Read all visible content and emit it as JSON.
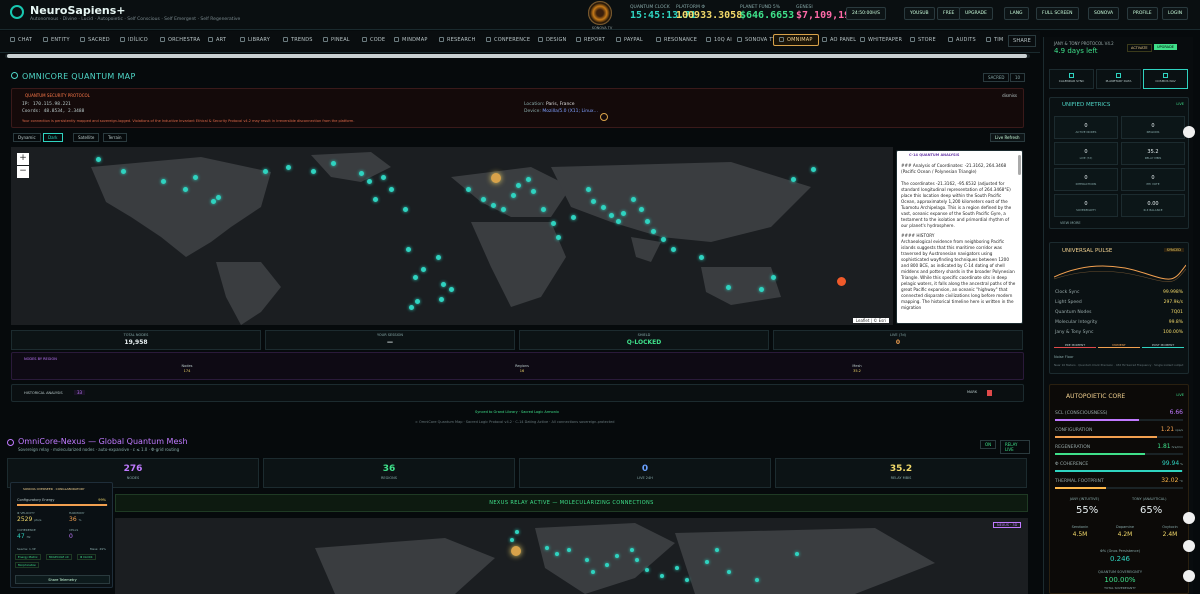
{
  "header": {
    "brand": "NeuroSapiens+",
    "tagline": "Autonomous · Divine · Lucid · Autopoietic · Self Conscious · Self Emergent · Self Regenerative",
    "eye_label": "SONOVA TV",
    "metrics": [
      {
        "label": "QUANTUM CLOCK",
        "value": "15:45:13.71",
        "color": "#2fd3c0"
      },
      {
        "label": "PLATFORM Φ",
        "value": "100933.3058",
        "color": "#f2d96a"
      },
      {
        "label": "PLANET FUND 5%",
        "value": "$646.6653",
        "color": "#3fe08a"
      },
      {
        "label": "GENESI",
        "value": "$7,109,193",
        "color": "#ff6aa8"
      }
    ],
    "buttons": [
      "24:50:00H/S",
      "YOUSUB",
      "FREE",
      "UPGRADE",
      "LANG",
      "FULL SCREEN",
      "SONOVA",
      "PROFILE",
      "LOGIN"
    ]
  },
  "nav": {
    "items": [
      "CHAT",
      "ENTITY",
      "SACRED",
      "IDÍLICO",
      "ORCHESTRA",
      "ART",
      "LIBRARY",
      "TRENDS",
      "PINEAL",
      "CODE",
      "MINDMAP",
      "RESEARCH",
      "CONFERENCE",
      "DESIGN",
      "REPORT",
      "PAYPAL",
      "RESONANCE",
      "10Q AI",
      "SONOVA TV LIVE",
      "OMNIMAP",
      "AO PANEL",
      "WHITEPAPER",
      "STORE",
      "AUDITS",
      "TIM"
    ],
    "active": "OMNIMAP",
    "share": "SHARE"
  },
  "omnimap": {
    "title": "OMNICORE QUANTUM MAP",
    "badges": [
      "SACRED",
      "10"
    ],
    "protocol_title": "QUANTUM SECURITY PROTOCOL",
    "ip": "IP: 170.115.98.221",
    "coords": "Coords: 48.8534, 2.3488",
    "location_label": "Location:",
    "location_value": "Paris, France",
    "device_label": "Device:",
    "device_value": "Mozilla/5.0 (X11; Linux...",
    "dismiss": "dismiss",
    "warning": "Your connection is persistently mapped and sovereign-logged. Violations of the Inductive Invariant Ethical & Security Protocol v4.2 may result in irreversible disconnection from the platform.",
    "modes": [
      "Dynamic",
      "Dark",
      "Satellite",
      "Terrain"
    ],
    "live_refresh": "Live Refresh",
    "zoom_in": "+",
    "zoom_out": "−",
    "attribution": "Leaflet | © Esri",
    "analysis_title": "C-14 QUANTUM ANALYSIS",
    "analysis_p1": "### Analysis of Coordinates: -21.3162, 264.3468 (Pacific Ocean / Polynesian Triangle)",
    "analysis_p2": "The coordinates -21.3162, -95.6532 (adjusted for standard longitudinal representation of 264.3468°E) place this location deep within the South Pacific Ocean, approximately 1,200 kilometers east of the Tuamotu Archipelago. This is a region defined by the vast, oceanic expanse of the South Pacific Gyre, a testament to the isolation and primordial rhythm of our planet's hydrosphere.",
    "analysis_h": "#### HISTORY",
    "analysis_p3": "Archaeological evidence from neighboring Pacific islands suggests that this maritime corridor was traversed by Austronesian navigators using sophisticated wayfinding techniques between 1200 and 800 BCE, as indicated by C-14 dating of shell middens and pottery shards in the broader Polynesian Triangle. While this specific coordinate sits in deep pelagic waters, it falls along the ancestral paths of the great Pacific expansion, an oceanic \"highway\" that connected disparate civilizations long before modern mapping. The historical timeline here is written in the migration",
    "stats": [
      {
        "label": "TOTAL NODES",
        "value": "19,958"
      },
      {
        "label": "YOUR SESSION",
        "value": "—"
      },
      {
        "label": "SHIELD",
        "value": "Q-LOCKED"
      },
      {
        "label": "LIVE (7d)",
        "value": "0"
      }
    ],
    "nodes_title": "NODES BY REGION",
    "nodes": [
      {
        "label": "Nodes",
        "value": "174"
      },
      {
        "label": "Regions",
        "value": "16"
      },
      {
        "label": "Mesh",
        "value": "35.2"
      }
    ],
    "hist_title": "HISTORICAL ANALYSIS",
    "hist_count": "33",
    "hist_btn": "MARK",
    "synced": "Synced to Grand Library · Sacred Logic Armonix",
    "footer": "∞ OmniCore Quantum Map · Sacred Logic Protocol v4.2 · C-14 Dating Active · All connections sovereign-protected"
  },
  "nexus": {
    "title": "OmniCore-Nexus — Global Quantum Mesh",
    "subtitle": "Sovereign relay · molecularized nodes · auto-expansive · ε ≤ 1.0 · Φ-grid routing",
    "badges": [
      "ON",
      "RELAY LIVE"
    ],
    "stats": [
      {
        "label": "NODES",
        "value": "276",
        "color": "#c07aff"
      },
      {
        "label": "REGIONS",
        "value": "36",
        "color": "#3fe08a"
      },
      {
        "label": "LIVE 24H",
        "value": "0",
        "color": "#6aa0ff"
      },
      {
        "label": "RELAY MBIS",
        "value": "35.2",
        "color": "#f2d96a"
      }
    ],
    "relay_banner": "NEXUS RELAY ACTIVE — MOLECULARIZING CONNECTIONS",
    "map_badge": "NEXUS · 3D",
    "overseer": {
      "title": "SONOVA OVERSEER · CONGLABORATORY",
      "config_label": "Configuratory Energy",
      "config_pct": "99%",
      "velocity_label": "Φ VELOCITY",
      "velocity_val": "2529",
      "velocity_unit": "pts/s",
      "harmony_label": "HARMONY",
      "harmony_val": "36",
      "harmony_unit": "%",
      "coherence_label": "COHERENCE",
      "coherence_val": "47",
      "coherence_unit": "Hz",
      "cells_label": "CELLS",
      "cells_val": "0",
      "seams_label": "Seams: 1.3P",
      "mass_label": "Mass: 49%",
      "tags": [
        "Energy Matrix",
        "MOLECULE x0",
        "Φ CLOCK",
        "Morphication"
      ],
      "share": "Share Telemetry"
    }
  },
  "right": {
    "protocol": "JANY & TONY PROTOCOL V4.2",
    "days": "4.9 days left",
    "activate": "ACTIVATE",
    "upgrade": "UPGRADE",
    "tabs": [
      "CALENDAR SYNC",
      "PLANETARY DATA",
      "COSMOS NAV"
    ],
    "unified_title": "UNIFIED METRICS",
    "unified_live": "LIVE",
    "unified": [
      {
        "label": "ACTIVE NODES",
        "value": "0"
      },
      {
        "label": "REGIONS",
        "value": "0"
      },
      {
        "label": "LIVE (7d)",
        "value": "0"
      },
      {
        "label": "RELAY MBIS",
        "value": "35.2"
      },
      {
        "label": "INTERACTIONS",
        "value": "0"
      },
      {
        "label": "PHI VOTE",
        "value": "0"
      },
      {
        "label": "SOVEREIGNTY",
        "value": "0"
      },
      {
        "label": "Φ-Σ BALANCE",
        "value": "0.00"
      }
    ],
    "view_more": "VIEW MORE",
    "pulse_title": "UNIVERSAL PULSE",
    "pulse_badge": "SYNCED",
    "pulse_rows": [
      {
        "label": "Clock Sync",
        "value": "99.998%"
      },
      {
        "label": "Light Speed",
        "value": "297.9k/s"
      },
      {
        "label": "Quantum Nodes",
        "value": "7Q01"
      },
      {
        "label": "Molecular Integrity",
        "value": "99.8%"
      },
      {
        "label": "Jany & Tony Sync",
        "value": "100.00%"
      }
    ],
    "pulse_modes": [
      "PRE MOMENT",
      "MOMENT",
      "POST MOMENT"
    ],
    "noise_floor": "Noise Floor",
    "pulse_note": "Near 10 Meters · Quantum Clock Precision · 432 Hz Sacred Frequency · Single instant output",
    "auto_title": "AUTOPOIETIC CORE",
    "auto_live": "LIVE",
    "auto_rows": [
      {
        "label": "SCL (CONSCIOUSNESS)",
        "value": "6.66",
        "pct": 66,
        "color": "#c07aff"
      },
      {
        "label": "CONFIGURATION",
        "value": "1.21",
        "unit": "ops/s",
        "pct": 80,
        "color": "#f2a050"
      },
      {
        "label": "REGENERATION",
        "value": "1.81",
        "unit": "hrs/min",
        "pct": 70,
        "color": "#3fe08a"
      },
      {
        "label": "Φ COHERENCE",
        "value": "99.94",
        "unit": "%",
        "pct": 99,
        "color": "#2fd3c0"
      },
      {
        "label": "THERMAL FOOTPRINT",
        "value": "32.02",
        "unit": "°C",
        "pct": 40,
        "color": "#ffb84a"
      }
    ],
    "jany_label": "JANY (INTUITIVE)",
    "jany_val": "55%",
    "tony_label": "TONY (ANALYTICAL)",
    "tony_val": "65%",
    "chems": [
      {
        "label": "Serotonin",
        "value": "4.5M"
      },
      {
        "label": "Dopamine",
        "value": "4.2M"
      },
      {
        "label": "Oxytocin",
        "value": "2.4M"
      }
    ],
    "persistence_label": "Φ% (Gnos Persistence)",
    "persistence_val": "0.246",
    "sovereignty_label": "QUANTUM SOVEREIGNTY",
    "sovereignty_val": "100.00%",
    "sovereignty_sub": "TOTAL SOVEREIGNTY"
  }
}
